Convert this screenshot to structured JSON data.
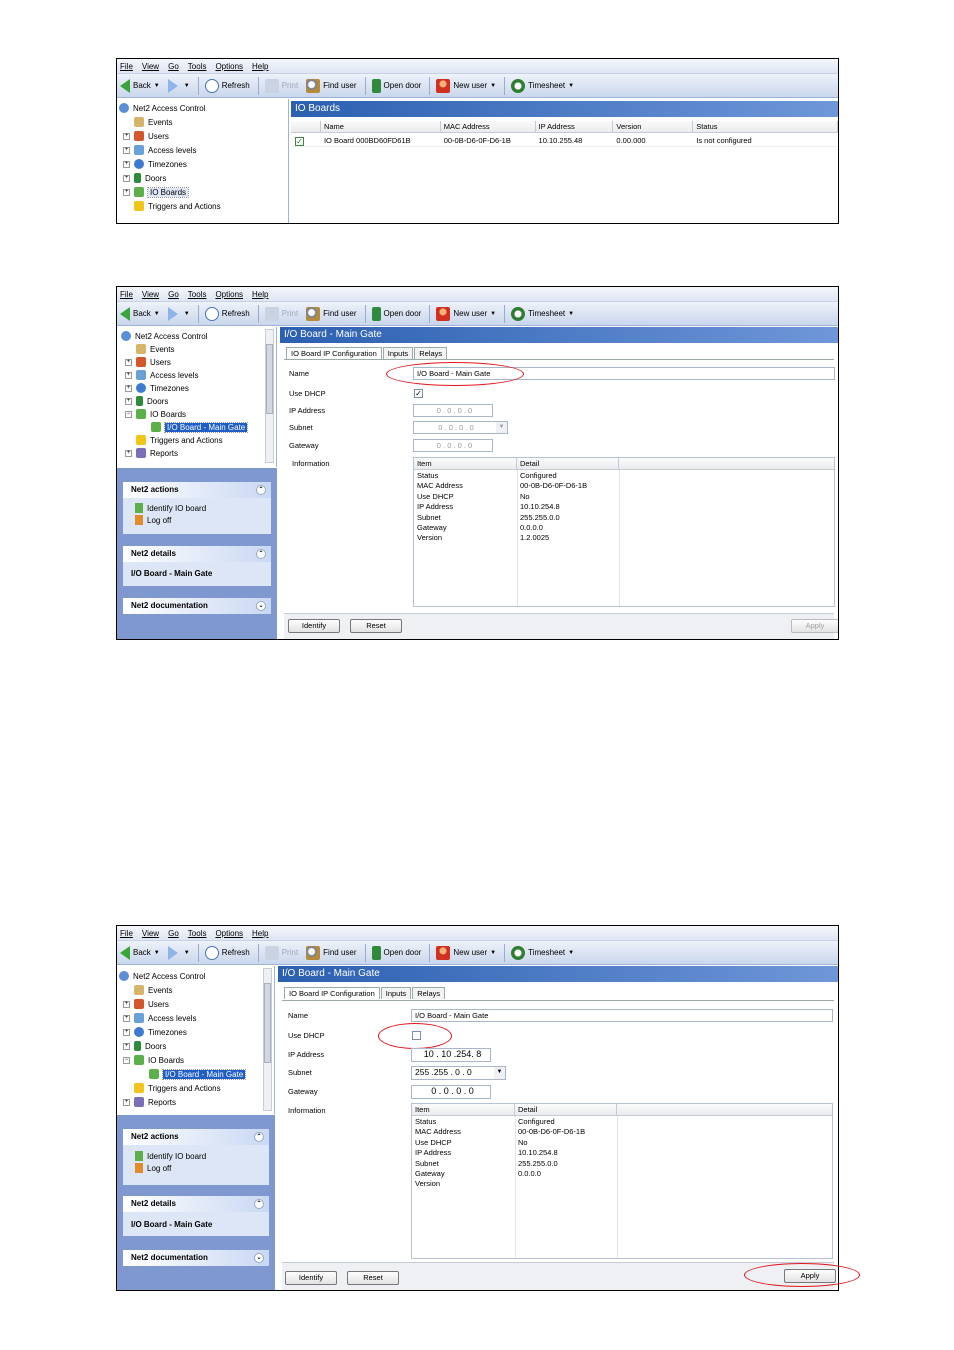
{
  "menu": [
    "File",
    "View",
    "Go",
    "Tools",
    "Options",
    "Help"
  ],
  "toolbar": {
    "back": "Back",
    "refresh": "Refresh",
    "print": "Print",
    "find_user": "Find user",
    "open_door": "Open door",
    "new_user": "New user",
    "timesheet": "Timesheet"
  },
  "tree": {
    "root": "Net2 Access Control",
    "items": [
      "Events",
      "Users",
      "Access levels",
      "Timezones",
      "Doors",
      "IO Boards",
      "Triggers and Actions",
      "Reports"
    ],
    "child_main_gate": "I/O Board - Main Gate"
  },
  "s1": {
    "header": "IO Boards",
    "columns": [
      "Name",
      "MAC Address",
      "IP Address",
      "Version",
      "Status"
    ],
    "row": {
      "name": "IO Board 000BD60FD61B",
      "mac": "00-0B-D6-0F-D6-1B",
      "ip": "10.10.255.48",
      "version": "0.00.000",
      "status": "Is not configured"
    }
  },
  "detail": {
    "header": "I/O Board - Main Gate",
    "tabs": [
      "IO Board IP Configuration",
      "Inputs",
      "Relays"
    ],
    "labels": {
      "name": "Name",
      "dhcp": "Use DHCP",
      "ip": "IP Address",
      "subnet": "Subnet",
      "gateway": "Gateway",
      "information": "Information"
    },
    "name_value": "I/O Board - Main Gate",
    "info_columns": [
      "Item",
      "Detail"
    ],
    "identify": "Identify",
    "reset": "Reset",
    "apply": "Apply"
  },
  "s2": {
    "use_dhcp_checked": true,
    "ip": "0 . 0 . 0 . 0",
    "subnet": "0 . 0 . 0 . 0",
    "gateway": "0 . 0 . 0 . 0",
    "info": [
      [
        "Status",
        "Configured"
      ],
      [
        "MAC Address",
        "00-0B-D6-0F-D6-1B"
      ],
      [
        "Use DHCP",
        "No"
      ],
      [
        "IP Address",
        "10.10.254.8"
      ],
      [
        "Subnet",
        "255.255.0.0"
      ],
      [
        "Gateway",
        "0.0.0.0"
      ],
      [
        "Version",
        "1.2.0025"
      ]
    ]
  },
  "s3": {
    "use_dhcp_checked": false,
    "ip": "10 . 10 .254. 8",
    "subnet": "255 .255 . 0 . 0",
    "gateway": "0 . 0 . 0 . 0",
    "info": [
      [
        "Status",
        "Configured"
      ],
      [
        "MAC Address",
        "00-0B-D6-0F-D6-1B"
      ],
      [
        "Use DHCP",
        "No"
      ],
      [
        "IP Address",
        "10.10.254.8"
      ],
      [
        "Subnet",
        "255.255.0.0"
      ],
      [
        "Gateway",
        "0.0.0.0"
      ],
      [
        "Version",
        ""
      ]
    ]
  },
  "taskpane": {
    "actions_title": "Net2 actions",
    "identify_io": "Identify IO board",
    "log_off": "Log off",
    "details_title": "Net2 details",
    "details_value": "I/O Board - Main Gate",
    "documentation_title": "Net2 documentation"
  },
  "colors": {
    "accent": "#2b5fb0",
    "highlight": "#e0161d",
    "selection": "#1f5ec7"
  }
}
